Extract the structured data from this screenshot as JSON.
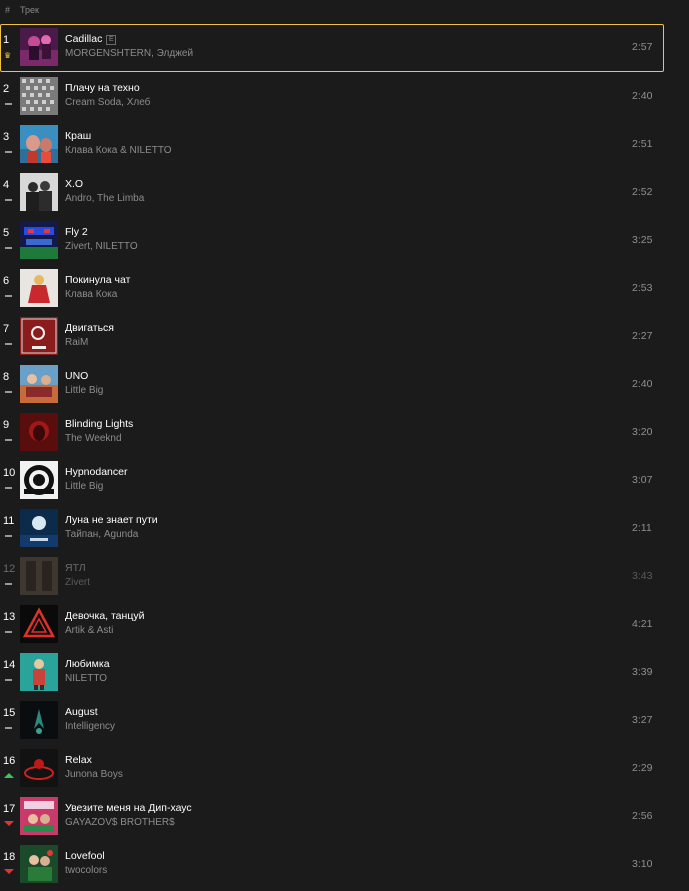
{
  "header": {
    "hash": "#",
    "track_col": "Трек"
  },
  "tracks": [
    {
      "num": "1",
      "title": "Cadillac",
      "explicit": "E",
      "artist": "MORGENSHTERN, Элджей",
      "duration": "2:57",
      "trend": "crown",
      "cover": "cover-cadillac"
    },
    {
      "num": "2",
      "title": "Плачу на техно",
      "artist": "Cream Soda, Хлеб",
      "duration": "2:40",
      "trend": "same",
      "cover": "cover-plachu"
    },
    {
      "num": "3",
      "title": "Краш",
      "artist": "Клава Кока & NILETTO",
      "duration": "2:51",
      "trend": "same",
      "cover": "cover-krash"
    },
    {
      "num": "4",
      "title": "X.O",
      "artist": "Andro, The Limba",
      "duration": "2:52",
      "trend": "same",
      "cover": "cover-xo"
    },
    {
      "num": "5",
      "title": "Fly 2",
      "artist": "Zivert, NILETTO",
      "duration": "3:25",
      "trend": "same",
      "cover": "cover-fly2"
    },
    {
      "num": "6",
      "title": "Покинула чат",
      "artist": "Клава Кока",
      "duration": "2:53",
      "trend": "same",
      "cover": "cover-pokinula"
    },
    {
      "num": "7",
      "title": "Двигаться",
      "artist": "RaiM",
      "duration": "2:27",
      "trend": "same",
      "cover": "cover-dvigatsya"
    },
    {
      "num": "8",
      "title": "UNO",
      "artist": "Little Big",
      "duration": "2:40",
      "trend": "same",
      "cover": "cover-uno"
    },
    {
      "num": "9",
      "title": "Blinding Lights",
      "artist": "The Weeknd",
      "duration": "3:20",
      "trend": "same",
      "cover": "cover-blinding"
    },
    {
      "num": "10",
      "title": "Hypnodancer",
      "artist": "Little Big",
      "duration": "3:07",
      "trend": "same",
      "cover": "cover-hypno"
    },
    {
      "num": "11",
      "title": "Луна не знает пути",
      "artist": "Тайпан, Agunda",
      "duration": "2:11",
      "trend": "same",
      "cover": "cover-luna"
    },
    {
      "num": "12",
      "title": "ЯТЛ",
      "artist": "Zivert",
      "duration": "3:43",
      "trend": "same",
      "cover": "cover-yatl",
      "dim": true
    },
    {
      "num": "13",
      "title": "Девочка, танцуй",
      "artist": "Artik & Asti",
      "duration": "4:21",
      "trend": "same",
      "cover": "cover-devochka"
    },
    {
      "num": "14",
      "title": "Любимка",
      "artist": "NILETTO",
      "duration": "3:39",
      "trend": "same",
      "cover": "cover-lyubimka"
    },
    {
      "num": "15",
      "title": "August",
      "artist": "Intelligency",
      "duration": "3:27",
      "trend": "same",
      "cover": "cover-august"
    },
    {
      "num": "16",
      "title": "Relax",
      "artist": "Junona Boys",
      "duration": "2:29",
      "trend": "up",
      "cover": "cover-relax"
    },
    {
      "num": "17",
      "title": "Увезите меня на Дип-хаус",
      "artist": "GAYAZOV$ BROTHER$",
      "duration": "2:56",
      "trend": "down",
      "cover": "cover-deephouse"
    },
    {
      "num": "18",
      "title": "Lovefool",
      "artist": "twocolors",
      "duration": "3:10",
      "trend": "down",
      "cover": "cover-lovefool"
    }
  ],
  "colors": {
    "background": "#1b1b1b",
    "active_border": "#f0c342",
    "trend_up": "#3cc35a",
    "trend_down": "#e5352f",
    "secondary_text": "#8c8c8c"
  }
}
